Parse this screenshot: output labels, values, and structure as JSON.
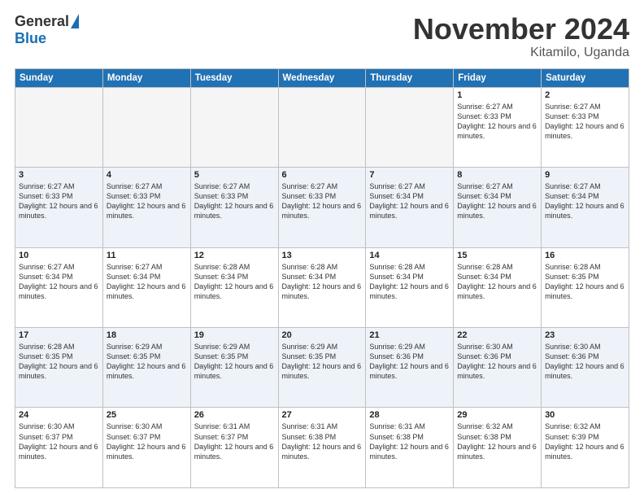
{
  "logo": {
    "general": "General",
    "blue": "Blue"
  },
  "title": "November 2024",
  "subtitle": "Kitamilo, Uganda",
  "days_of_week": [
    "Sunday",
    "Monday",
    "Tuesday",
    "Wednesday",
    "Thursday",
    "Friday",
    "Saturday"
  ],
  "weeks": [
    [
      {
        "day": "",
        "info": ""
      },
      {
        "day": "",
        "info": ""
      },
      {
        "day": "",
        "info": ""
      },
      {
        "day": "",
        "info": ""
      },
      {
        "day": "",
        "info": ""
      },
      {
        "day": "1",
        "info": "Sunrise: 6:27 AM\nSunset: 6:33 PM\nDaylight: 12 hours and 6 minutes."
      },
      {
        "day": "2",
        "info": "Sunrise: 6:27 AM\nSunset: 6:33 PM\nDaylight: 12 hours and 6 minutes."
      }
    ],
    [
      {
        "day": "3",
        "info": "Sunrise: 6:27 AM\nSunset: 6:33 PM\nDaylight: 12 hours and 6 minutes."
      },
      {
        "day": "4",
        "info": "Sunrise: 6:27 AM\nSunset: 6:33 PM\nDaylight: 12 hours and 6 minutes."
      },
      {
        "day": "5",
        "info": "Sunrise: 6:27 AM\nSunset: 6:33 PM\nDaylight: 12 hours and 6 minutes."
      },
      {
        "day": "6",
        "info": "Sunrise: 6:27 AM\nSunset: 6:33 PM\nDaylight: 12 hours and 6 minutes."
      },
      {
        "day": "7",
        "info": "Sunrise: 6:27 AM\nSunset: 6:34 PM\nDaylight: 12 hours and 6 minutes."
      },
      {
        "day": "8",
        "info": "Sunrise: 6:27 AM\nSunset: 6:34 PM\nDaylight: 12 hours and 6 minutes."
      },
      {
        "day": "9",
        "info": "Sunrise: 6:27 AM\nSunset: 6:34 PM\nDaylight: 12 hours and 6 minutes."
      }
    ],
    [
      {
        "day": "10",
        "info": "Sunrise: 6:27 AM\nSunset: 6:34 PM\nDaylight: 12 hours and 6 minutes."
      },
      {
        "day": "11",
        "info": "Sunrise: 6:27 AM\nSunset: 6:34 PM\nDaylight: 12 hours and 6 minutes."
      },
      {
        "day": "12",
        "info": "Sunrise: 6:28 AM\nSunset: 6:34 PM\nDaylight: 12 hours and 6 minutes."
      },
      {
        "day": "13",
        "info": "Sunrise: 6:28 AM\nSunset: 6:34 PM\nDaylight: 12 hours and 6 minutes."
      },
      {
        "day": "14",
        "info": "Sunrise: 6:28 AM\nSunset: 6:34 PM\nDaylight: 12 hours and 6 minutes."
      },
      {
        "day": "15",
        "info": "Sunrise: 6:28 AM\nSunset: 6:34 PM\nDaylight: 12 hours and 6 minutes."
      },
      {
        "day": "16",
        "info": "Sunrise: 6:28 AM\nSunset: 6:35 PM\nDaylight: 12 hours and 6 minutes."
      }
    ],
    [
      {
        "day": "17",
        "info": "Sunrise: 6:28 AM\nSunset: 6:35 PM\nDaylight: 12 hours and 6 minutes."
      },
      {
        "day": "18",
        "info": "Sunrise: 6:29 AM\nSunset: 6:35 PM\nDaylight: 12 hours and 6 minutes."
      },
      {
        "day": "19",
        "info": "Sunrise: 6:29 AM\nSunset: 6:35 PM\nDaylight: 12 hours and 6 minutes."
      },
      {
        "day": "20",
        "info": "Sunrise: 6:29 AM\nSunset: 6:35 PM\nDaylight: 12 hours and 6 minutes."
      },
      {
        "day": "21",
        "info": "Sunrise: 6:29 AM\nSunset: 6:36 PM\nDaylight: 12 hours and 6 minutes."
      },
      {
        "day": "22",
        "info": "Sunrise: 6:30 AM\nSunset: 6:36 PM\nDaylight: 12 hours and 6 minutes."
      },
      {
        "day": "23",
        "info": "Sunrise: 6:30 AM\nSunset: 6:36 PM\nDaylight: 12 hours and 6 minutes."
      }
    ],
    [
      {
        "day": "24",
        "info": "Sunrise: 6:30 AM\nSunset: 6:37 PM\nDaylight: 12 hours and 6 minutes."
      },
      {
        "day": "25",
        "info": "Sunrise: 6:30 AM\nSunset: 6:37 PM\nDaylight: 12 hours and 6 minutes."
      },
      {
        "day": "26",
        "info": "Sunrise: 6:31 AM\nSunset: 6:37 PM\nDaylight: 12 hours and 6 minutes."
      },
      {
        "day": "27",
        "info": "Sunrise: 6:31 AM\nSunset: 6:38 PM\nDaylight: 12 hours and 6 minutes."
      },
      {
        "day": "28",
        "info": "Sunrise: 6:31 AM\nSunset: 6:38 PM\nDaylight: 12 hours and 6 minutes."
      },
      {
        "day": "29",
        "info": "Sunrise: 6:32 AM\nSunset: 6:38 PM\nDaylight: 12 hours and 6 minutes."
      },
      {
        "day": "30",
        "info": "Sunrise: 6:32 AM\nSunset: 6:39 PM\nDaylight: 12 hours and 6 minutes."
      }
    ]
  ]
}
